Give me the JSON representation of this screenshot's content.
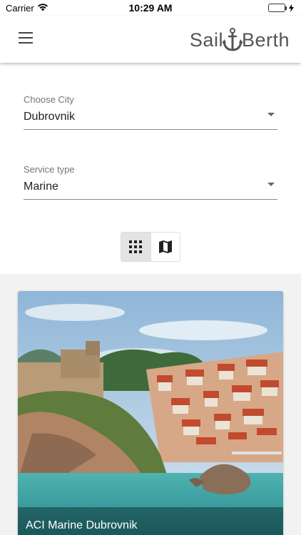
{
  "status_bar": {
    "carrier": "Carrier",
    "time": "10:29 AM",
    "battery_level": 1.0
  },
  "header": {
    "menu_icon": "hamburger-menu-icon",
    "logo_text_left": "Sail",
    "logo_text_right": "Berth",
    "logo_icon": "anchor-icon"
  },
  "filters": {
    "city": {
      "label": "Choose City",
      "value": "Dubrovnik"
    },
    "service": {
      "label": "Service type",
      "value": "Marine"
    }
  },
  "view_toggle": {
    "options": [
      {
        "icon": "grid-icon",
        "active": true
      },
      {
        "icon": "map-icon",
        "active": false
      }
    ]
  },
  "results": [
    {
      "title": "ACI Marine Dubrovnik"
    }
  ],
  "colors": {
    "accent_battery": "#4cd964",
    "background": "#f2f2f2",
    "surface": "#ffffff"
  }
}
